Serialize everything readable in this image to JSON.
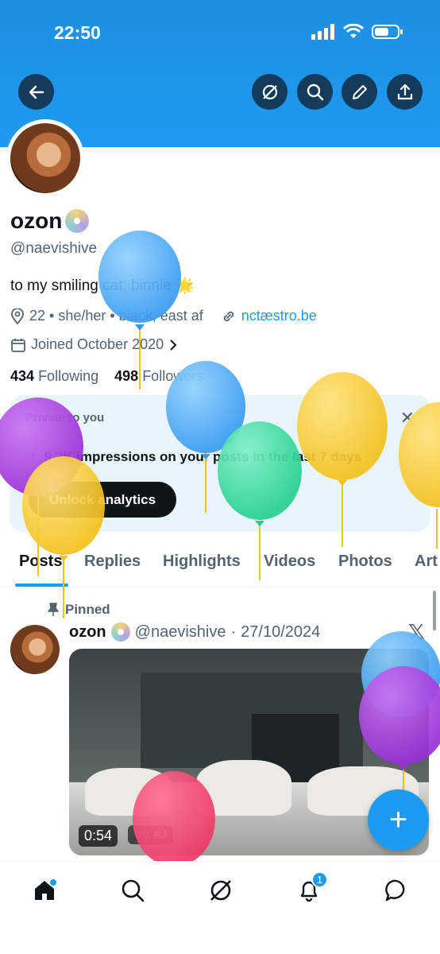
{
  "status": {
    "time": "22:50"
  },
  "header": {
    "back_icon": "arrow-left-icon",
    "actions": [
      "grok-icon",
      "search-icon",
      "edit-icon",
      "share-icon"
    ]
  },
  "profile": {
    "name": "ozon",
    "handle": "@naevishive",
    "bio": "to my smiling cat, binnie",
    "bio_emoji": "🌟",
    "meta": "22 • she/her • black, east af",
    "link": "nctæstro.be",
    "joined": "Joined October 2020",
    "following_count": "434",
    "following_label": "Following",
    "followers_count": "498",
    "followers_label": "Followers"
  },
  "analytics_card": {
    "label": "Private to you",
    "arrow": "↑",
    "text": "9.2K impressions on your posts in the last 7 days",
    "button": "Unlock analytics",
    "close": "✕"
  },
  "tabs": [
    "Posts",
    "Replies",
    "Highlights",
    "Videos",
    "Photos",
    "Art"
  ],
  "post": {
    "pinned_label": "Pinned",
    "name": "ozon",
    "handle": "@naevishive",
    "separator": "·",
    "date": "27/10/2024",
    "x_logo": "𝕏",
    "video_time": "0:54",
    "video_tag": "○○ #J"
  },
  "fab": {
    "label": "+"
  },
  "bottom_nav": {
    "items": [
      "home-icon",
      "search-icon",
      "grok-icon",
      "bell-icon",
      "messages-icon"
    ],
    "notification_count": "1"
  },
  "colors": {
    "banner": "#1d8fe0",
    "accent": "#1d9bf0",
    "dark": "#0f1419",
    "muted": "#536471",
    "card_bg": "#e8f5fd"
  }
}
